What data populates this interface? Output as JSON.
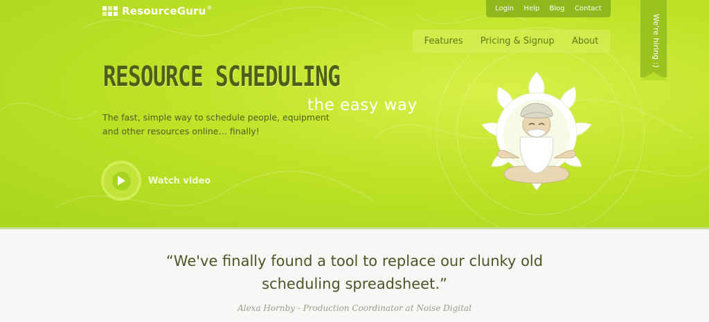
{
  "logo": {
    "text": "ResourceGuru",
    "registered": "®"
  },
  "utility_nav": {
    "items": [
      {
        "label": "Login"
      },
      {
        "label": "Help"
      },
      {
        "label": "Blog"
      },
      {
        "label": "Contact"
      }
    ]
  },
  "main_nav": {
    "items": [
      {
        "label": "Features"
      },
      {
        "label": "Pricing & Signup"
      },
      {
        "label": "About"
      }
    ]
  },
  "hiring_tab": {
    "label": "We're hiring :)"
  },
  "hero": {
    "headline": "RESOURCE SCHEDULING",
    "subheadline": "the easy way",
    "tagline": "The fast, simple way to schedule people, equipment and other resources online… finally!",
    "watch_video_label": "Watch video",
    "illustration_icon": "meditating-guru-icon"
  },
  "testimonial": {
    "quote_line1": "“We've finally found a tool to replace our clunky old",
    "quote_line2": "scheduling spreadsheet.”",
    "attribution": "Alexa Hornby - Production Coordinator at Noise Digital"
  },
  "colors": {
    "hero_green": "#bfe328",
    "nav_dark_green": "#8fb81a",
    "headline_olive": "#4e5f1c",
    "page_background": "#f7f7f5"
  }
}
